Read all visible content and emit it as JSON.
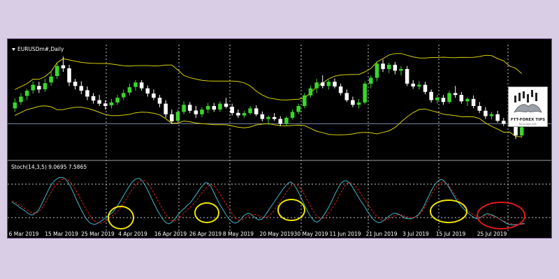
{
  "colors": {
    "bull": "#39d62a",
    "bear": "#ffffff",
    "band": "#d8d000",
    "stoch_main": "#3fb8c8",
    "stoch_signal": "#e02020",
    "grid": "#c8c8c8",
    "circle_yellow": "#f2e600",
    "circle_red": "#e01818",
    "level_line": "#7a8aa8"
  },
  "logo": {
    "text": "FTT-FOREX TIPS",
    "sub": "forex-tips.com",
    "icon": "bull-bear-logo-icon"
  },
  "chart_data": [
    {
      "type": "candlestick",
      "title": "EURUSDm#,Daily",
      "bands": [
        "upper",
        "lower"
      ],
      "ylim": [
        1.099,
        1.144
      ],
      "level": 1.114,
      "candles": [
        [
          1.1205,
          1.1248,
          1.119,
          1.123
        ],
        [
          1.1232,
          1.127,
          1.122,
          1.1255
        ],
        [
          1.1258,
          1.1288,
          1.124,
          1.128
        ],
        [
          1.1282,
          1.132,
          1.1268,
          1.1305
        ],
        [
          1.13,
          1.1318,
          1.127,
          1.1285
        ],
        [
          1.1286,
          1.133,
          1.1275,
          1.1312
        ],
        [
          1.1315,
          1.1362,
          1.13,
          1.134
        ],
        [
          1.1342,
          1.14,
          1.133,
          1.1385
        ],
        [
          1.1388,
          1.1425,
          1.136,
          1.1375
        ],
        [
          1.1375,
          1.139,
          1.13,
          1.1315
        ],
        [
          1.1318,
          1.133,
          1.1285,
          1.13
        ],
        [
          1.13,
          1.132,
          1.1265,
          1.128
        ],
        [
          1.1282,
          1.1298,
          1.124,
          1.1255
        ],
        [
          1.1257,
          1.127,
          1.1225,
          1.1238
        ],
        [
          1.124,
          1.1262,
          1.1215,
          1.1225
        ],
        [
          1.1226,
          1.124,
          1.12,
          1.1215
        ],
        [
          1.1218,
          1.1245,
          1.1205,
          1.123
        ],
        [
          1.123,
          1.1262,
          1.122,
          1.125
        ],
        [
          1.1252,
          1.1285,
          1.124,
          1.127
        ],
        [
          1.1272,
          1.131,
          1.126,
          1.1295
        ],
        [
          1.1296,
          1.1325,
          1.128,
          1.1315
        ],
        [
          1.1315,
          1.1325,
          1.128,
          1.129
        ],
        [
          1.129,
          1.1302,
          1.1255,
          1.1268
        ],
        [
          1.1268,
          1.1285,
          1.124,
          1.125
        ],
        [
          1.125,
          1.1262,
          1.121,
          1.1225
        ],
        [
          1.1225,
          1.124,
          1.1165,
          1.118
        ],
        [
          1.118,
          1.12,
          1.114,
          1.115
        ],
        [
          1.1152,
          1.12,
          1.1145,
          1.119
        ],
        [
          1.119,
          1.1235,
          1.118,
          1.122
        ],
        [
          1.122,
          1.1232,
          1.1185,
          1.1195
        ],
        [
          1.1196,
          1.1215,
          1.1165,
          1.118
        ],
        [
          1.118,
          1.121,
          1.1168,
          1.12
        ],
        [
          1.12,
          1.1228,
          1.1185,
          1.1215
        ],
        [
          1.1215,
          1.1228,
          1.119,
          1.12
        ],
        [
          1.12,
          1.1235,
          1.119,
          1.1225
        ],
        [
          1.1225,
          1.125,
          1.1205,
          1.1212
        ],
        [
          1.1212,
          1.1225,
          1.1175,
          1.1185
        ],
        [
          1.1186,
          1.12,
          1.1165,
          1.1175
        ],
        [
          1.1175,
          1.1195,
          1.1165,
          1.1185
        ],
        [
          1.1185,
          1.1215,
          1.1178,
          1.1205
        ],
        [
          1.1205,
          1.1218,
          1.1172,
          1.118
        ],
        [
          1.118,
          1.1192,
          1.115,
          1.116
        ],
        [
          1.116,
          1.1175,
          1.1135,
          1.1168
        ],
        [
          1.1168,
          1.1185,
          1.1152,
          1.116
        ],
        [
          1.116,
          1.1172,
          1.113,
          1.114
        ],
        [
          1.114,
          1.1172,
          1.113,
          1.1165
        ],
        [
          1.1165,
          1.12,
          1.1158,
          1.119
        ],
        [
          1.119,
          1.1225,
          1.118,
          1.1215
        ],
        [
          1.1215,
          1.127,
          1.1205,
          1.126
        ],
        [
          1.126,
          1.13,
          1.125,
          1.129
        ],
        [
          1.129,
          1.133,
          1.127,
          1.1315
        ],
        [
          1.1315,
          1.1345,
          1.129,
          1.13
        ],
        [
          1.13,
          1.1325,
          1.1285,
          1.1318
        ],
        [
          1.1318,
          1.1332,
          1.129,
          1.1298
        ],
        [
          1.1298,
          1.131,
          1.126,
          1.127
        ],
        [
          1.127,
          1.1285,
          1.1232,
          1.124
        ],
        [
          1.124,
          1.1255,
          1.121,
          1.122
        ],
        [
          1.122,
          1.1245,
          1.1205,
          1.123
        ],
        [
          1.123,
          1.132,
          1.1222,
          1.131
        ],
        [
          1.131,
          1.1345,
          1.129,
          1.1335
        ],
        [
          1.1335,
          1.1405,
          1.132,
          1.1395
        ],
        [
          1.1395,
          1.1412,
          1.136,
          1.1372
        ],
        [
          1.1372,
          1.14,
          1.1355,
          1.139
        ],
        [
          1.139,
          1.1402,
          1.135,
          1.1365
        ],
        [
          1.1365,
          1.1385,
          1.1345,
          1.1372
        ],
        [
          1.1372,
          1.1385,
          1.13,
          1.131
        ],
        [
          1.131,
          1.1325,
          1.1288,
          1.1298
        ],
        [
          1.1298,
          1.132,
          1.1285,
          1.1305
        ],
        [
          1.1305,
          1.1318,
          1.1265,
          1.1275
        ],
        [
          1.1275,
          1.1285,
          1.123,
          1.124
        ],
        [
          1.124,
          1.1262,
          1.1225,
          1.125
        ],
        [
          1.125,
          1.1262,
          1.122,
          1.1232
        ],
        [
          1.1232,
          1.128,
          1.1225,
          1.127
        ],
        [
          1.127,
          1.13,
          1.125,
          1.1262
        ],
        [
          1.1262,
          1.1275,
          1.1225,
          1.1235
        ],
        [
          1.1235,
          1.1252,
          1.1215,
          1.1245
        ],
        [
          1.1245,
          1.126,
          1.1205,
          1.1215
        ],
        [
          1.1215,
          1.1232,
          1.1185,
          1.1195
        ],
        [
          1.1195,
          1.121,
          1.116,
          1.1172
        ],
        [
          1.1172,
          1.119,
          1.1158,
          1.118
        ],
        [
          1.118,
          1.1195,
          1.1145,
          1.1152
        ],
        [
          1.1152,
          1.1165,
          1.113,
          1.114
        ],
        [
          1.114,
          1.1182,
          1.1135,
          1.1175
        ],
        [
          1.1175,
          1.118,
          1.1075,
          1.109
        ],
        [
          1.109,
          1.1135,
          1.108,
          1.1125
        ]
      ]
    },
    {
      "type": "line",
      "title": "Stoch(14,3,5) 9.0695 7.5865",
      "ylim": [
        0,
        100
      ],
      "levels": [
        20,
        80
      ],
      "series": [
        {
          "values": [
            48,
            45,
            42,
            38,
            35,
            32,
            28,
            25,
            25,
            29,
            33,
            42,
            52,
            62,
            72,
            80,
            86,
            90,
            92,
            92,
            90,
            84,
            76,
            66,
            55,
            45,
            35,
            26,
            18,
            12,
            9,
            8,
            9,
            12,
            15,
            19,
            22,
            26,
            30,
            36,
            43,
            51,
            59,
            67,
            75,
            82,
            87,
            90,
            90,
            86,
            79,
            70,
            60,
            50,
            40,
            31,
            23,
            16,
            11,
            9,
            11,
            16,
            22,
            28,
            33,
            37,
            42,
            46,
            52,
            59,
            66,
            73,
            79,
            83,
            81,
            75,
            65,
            55,
            46,
            38,
            30,
            22,
            16,
            12,
            10,
            12,
            16,
            22,
            26,
            28,
            26,
            22,
            18,
            16,
            17,
            22,
            29,
            36,
            43,
            50,
            57,
            64,
            71,
            77,
            82,
            84,
            80,
            73,
            64,
            54,
            44,
            34,
            25,
            18,
            13,
            12,
            16,
            22,
            29,
            37,
            46,
            56,
            66,
            75,
            82,
            86,
            86,
            82,
            76,
            68,
            60,
            52,
            45,
            38,
            30,
            23,
            17,
            13,
            11,
            12,
            15,
            19,
            23,
            26,
            28,
            27,
            25,
            22,
            19,
            18,
            18,
            19,
            22,
            26,
            32,
            40,
            50,
            60,
            70,
            78,
            84,
            88,
            88,
            84,
            78,
            70,
            62,
            54,
            47,
            41,
            36,
            31,
            27,
            23,
            20,
            18,
            19,
            22,
            26,
            27,
            26,
            24,
            22,
            19,
            16,
            13,
            10,
            8,
            7,
            7,
            8,
            8,
            9,
            9
          ]
        },
        {
          "values": [
            50,
            48,
            45,
            42,
            39,
            36,
            33,
            30,
            28,
            28,
            30,
            35,
            42,
            50,
            59,
            67,
            75,
            81,
            86,
            89,
            90,
            88,
            84,
            78,
            70,
            61,
            52,
            43,
            34,
            26,
            19,
            14,
            11,
            10,
            11,
            13,
            16,
            20,
            24,
            28,
            33,
            39,
            46,
            53,
            61,
            68,
            75,
            81,
            85,
            87,
            86,
            82,
            76,
            68,
            59,
            50,
            41,
            33,
            25,
            19,
            15,
            14,
            16,
            20,
            24,
            29,
            34,
            38,
            43,
            48,
            54,
            61,
            67,
            73,
            77,
            79,
            77,
            72,
            65,
            57,
            49,
            41,
            33,
            26,
            20,
            16,
            15,
            17,
            20,
            23,
            25,
            26,
            25,
            23,
            21,
            20,
            21,
            24,
            29,
            35,
            42,
            49,
            56,
            63,
            70,
            76,
            80,
            80,
            76,
            70,
            62,
            53,
            44,
            35,
            27,
            21,
            18,
            18,
            21,
            26,
            32,
            40,
            49,
            58,
            67,
            75,
            81,
            83,
            82,
            78,
            72,
            65,
            58,
            51,
            44,
            37,
            30,
            24,
            19,
            16,
            15,
            16,
            18,
            21,
            23,
            25,
            25,
            24,
            22,
            21,
            20,
            20,
            21,
            24,
            29,
            36,
            44,
            53,
            62,
            70,
            77,
            82,
            84,
            83,
            79,
            73,
            66,
            59,
            52,
            46,
            40,
            35,
            31,
            27,
            24,
            22,
            21,
            22,
            23,
            24,
            24,
            23,
            21,
            19,
            16,
            14,
            12,
            10,
            9,
            8,
            8,
            8,
            8,
            8
          ]
        }
      ],
      "x_ticks": [
        "6 Mar 2019",
        "15 Mar 2019",
        "25 Mar 2019",
        "4 Apr 2019",
        "16 Apr 2019",
        "26 Apr 2019",
        "8 May 2019",
        "20 May 2019",
        "30 May 2019",
        "11 Jun 2019",
        "21 Jun 2019",
        "3 Jul 2019",
        "15 Jul 2019",
        "25 Jul 2019"
      ],
      "annotations": [
        "yellow-circle",
        "yellow-circle",
        "yellow-circle",
        "yellow-circle",
        "red-circle"
      ]
    }
  ]
}
